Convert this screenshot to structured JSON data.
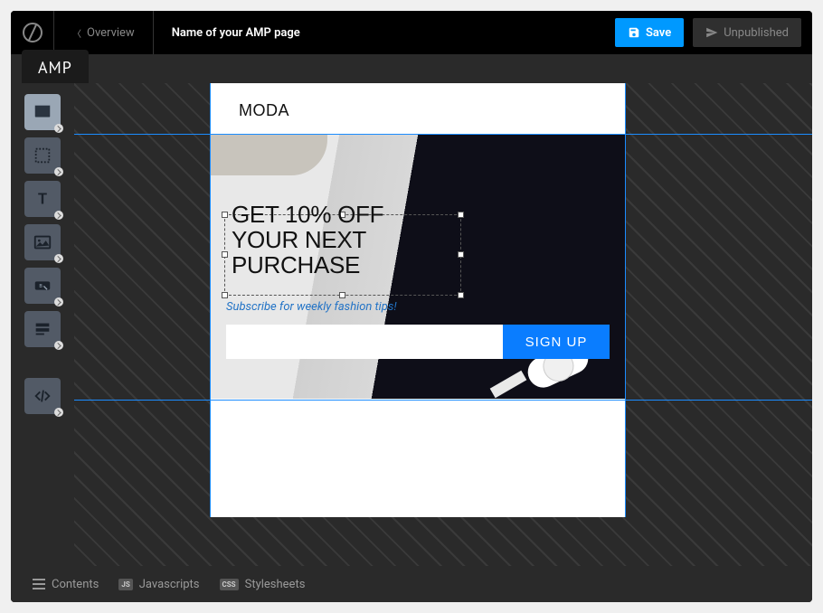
{
  "header": {
    "overview": "Overview",
    "title": "Name of your AMP page",
    "save": "Save",
    "publish_status": "Unpublished"
  },
  "tab": "AMP",
  "tools": [
    {
      "name": "section-tool",
      "active": true
    },
    {
      "name": "box-tool",
      "active": false
    },
    {
      "name": "text-tool",
      "active": false
    },
    {
      "name": "image-tool",
      "active": false
    },
    {
      "name": "button-tool",
      "active": false
    },
    {
      "name": "form-tool",
      "active": false
    },
    {
      "name": "code-tool",
      "active": false
    }
  ],
  "canvas": {
    "brand": "MODA",
    "headline": "GET 10% OFF\nYOUR NEXT\nPURCHASE",
    "subtext": "Subscribe for weekly fashion tips!",
    "cta": "SIGN UP"
  },
  "bottombar": {
    "contents": "Contents",
    "js_badge": "JS",
    "js": "Javascripts",
    "css_badge": "CSS",
    "css": "Stylesheets"
  }
}
